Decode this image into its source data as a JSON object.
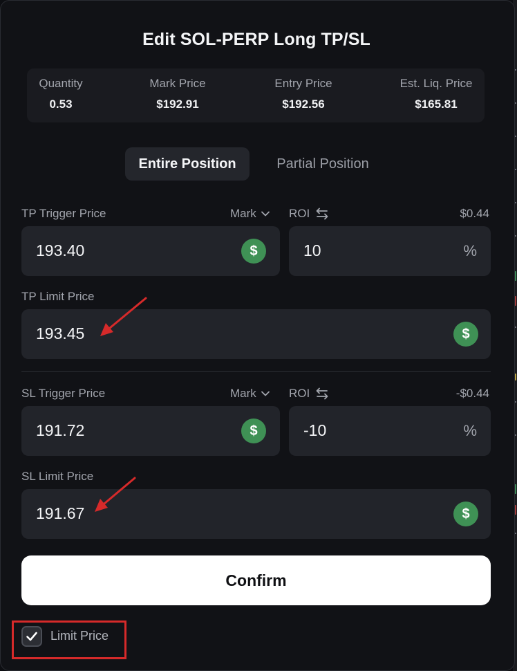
{
  "dialog": {
    "title": "Edit SOL-PERP Long TP/SL"
  },
  "summary": {
    "quantity_label": "Quantity",
    "quantity_value": "0.53",
    "mark_label": "Mark Price",
    "mark_value": "$192.91",
    "entry_label": "Entry Price",
    "entry_value": "$192.56",
    "liq_label": "Est. Liq. Price",
    "liq_value": "$165.81"
  },
  "tabs": {
    "entire": "Entire Position",
    "partial": "Partial Position",
    "active": "entire"
  },
  "tp": {
    "trigger_label": "TP Trigger Price",
    "price_type": "Mark",
    "roi_label": "ROI",
    "pnl": "$0.44",
    "trigger_value": "193.40",
    "roi_value": "10",
    "roi_unit": "%",
    "limit_label": "TP Limit Price",
    "limit_value": "193.45"
  },
  "sl": {
    "trigger_label": "SL Trigger Price",
    "price_type": "Mark",
    "roi_label": "ROI",
    "pnl": "-$0.44",
    "trigger_value": "191.72",
    "roi_value": "-10",
    "roi_unit": "%",
    "limit_label": "SL Limit Price",
    "limit_value": "191.67"
  },
  "currency_symbol": "$",
  "confirm_label": "Confirm",
  "limit_price_toggle": {
    "label": "Limit Price",
    "checked": true
  },
  "colors": {
    "accent_green": "#3f9155",
    "annotation_red": "#d62a2a",
    "background": "#111216"
  },
  "icons": [
    "chevron-down-icon",
    "swap-arrows-icon",
    "dollar-icon",
    "check-icon",
    "arrow-annotation"
  ]
}
